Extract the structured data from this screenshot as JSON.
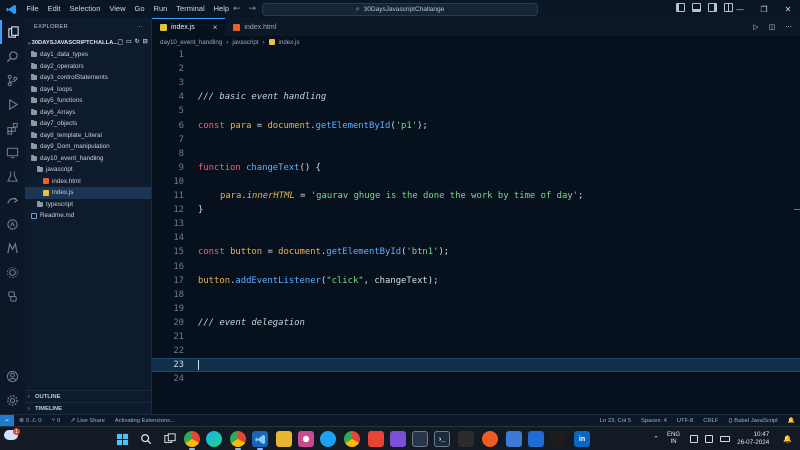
{
  "titlebar": {
    "menu": [
      "File",
      "Edit",
      "Selection",
      "View",
      "Go",
      "Run",
      "Terminal",
      "Help"
    ],
    "search": "30DaysJavascriptChallange"
  },
  "sidebar": {
    "title": "EXPLORER",
    "title_more": "···",
    "root": "30DAYSJAVASCRIPTCHALLA...",
    "items": [
      {
        "label": "day1_data_types"
      },
      {
        "label": "day2_operators"
      },
      {
        "label": "day3_controlStatements"
      },
      {
        "label": "day4_loops"
      },
      {
        "label": "day5_functions"
      },
      {
        "label": "day6_Arrays"
      },
      {
        "label": "day7_objects"
      },
      {
        "label": "day8_template_Literal"
      },
      {
        "label": "day9_Dom_manipulation"
      },
      {
        "label": "day10_event_handling"
      },
      {
        "label": "javascript"
      },
      {
        "label": "index.html"
      },
      {
        "label": "index.js"
      },
      {
        "label": "typescript"
      },
      {
        "label": "Readme.md"
      }
    ],
    "outline": "OUTLINE",
    "timeline": "TIMELINE"
  },
  "tabs": [
    {
      "label": "index.js",
      "close": "×"
    },
    {
      "label": "index.html"
    }
  ],
  "breadcrumb": [
    "day10_event_handling",
    "javascript",
    "index.js"
  ],
  "editor": {
    "line_numbers": [
      "1",
      "2",
      "3",
      "4",
      "5",
      "6",
      "7",
      "8",
      "9",
      "10",
      "11",
      "12",
      "13",
      "14",
      "15",
      "16",
      "17",
      "18",
      "19",
      "20",
      "21",
      "22",
      "23",
      "24"
    ],
    "current_line": 23,
    "lines": {
      "l4": "/// basic event handling",
      "l6": {
        "kw": "const",
        "var": "para",
        "eq": " = ",
        "obj": "document",
        "dot": ".",
        "fn": "getElementById",
        "open": "(",
        "str": "'p1'",
        "close": ");"
      },
      "l9": {
        "kw": "function",
        "fn": "changeText",
        "rest": "() {"
      },
      "l11": {
        "obj": "para",
        "dot": ".",
        "prop": "innerHTML",
        "eq": " = ",
        "str": "'gaurav ghuge is the done the work by time of day'",
        "end": ";"
      },
      "l12": "}",
      "l15": {
        "kw": "const",
        "var": "button",
        "eq": " = ",
        "obj": "document",
        "dot": ".",
        "fn": "getElementById",
        "open": "(",
        "str": "'btn1'",
        "close": ");"
      },
      "l17": {
        "obj": "button",
        "dot": ".",
        "fn": "addEventListener",
        "open": "(",
        "str": "\"click\"",
        "rest": ", changeText);"
      },
      "l20": "/// event delegation"
    }
  },
  "statusbar": {
    "errors": "0",
    "warnings": "0",
    "ports": "0",
    "live_share": "Live Share",
    "activity": "Activating Extensions...",
    "position": "Ln 23, Col 5",
    "spaces": "Spaces: 4",
    "encoding": "UTF-8",
    "eol": "CRLF",
    "language": "Babel JavaScript"
  },
  "taskbar": {
    "weather_badge": "1",
    "lang_top": "ENG",
    "lang_bottom": "IN",
    "time": "10:47",
    "date": "26-07-2024"
  },
  "colors": {
    "accent": "#3aa0ff",
    "keyword": "#ff5c6c",
    "function": "#5fb0ff",
    "string": "#7bd88f",
    "variable": "#eab14c"
  }
}
